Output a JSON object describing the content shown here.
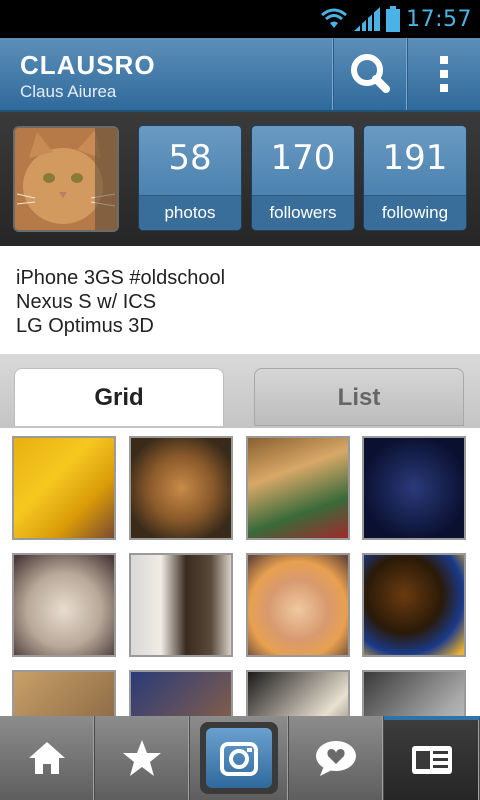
{
  "status_bar": {
    "time": "17:57"
  },
  "action_bar": {
    "username": "CLAUSRO",
    "full_name": "Claus Aiurea"
  },
  "stats": [
    {
      "value": "58",
      "label": "photos"
    },
    {
      "value": "170",
      "label": "followers"
    },
    {
      "value": "191",
      "label": "following"
    }
  ],
  "bio": [
    "iPhone 3GS #oldschool",
    "Nexus S w/ ICS",
    "LG Optimus 3D"
  ],
  "tabs": {
    "grid": "Grid",
    "list": "List",
    "selected": "Grid"
  },
  "colors": {
    "accent": "#2f6a9c",
    "status_icons": "#4ab3e6"
  },
  "bottom_nav": [
    "home-icon",
    "star-icon",
    "camera-icon",
    "news-bubble-icon",
    "profile-card-icon"
  ]
}
